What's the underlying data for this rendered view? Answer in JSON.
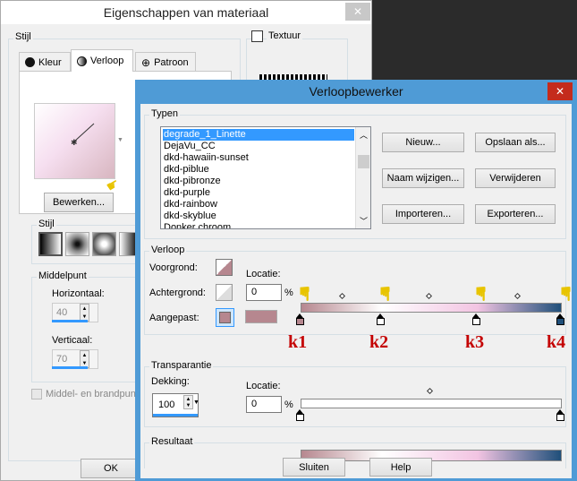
{
  "bg_dialog": {
    "title": "Eigenschappen van materiaal",
    "close_glyph": "✕",
    "group_stijl": "Stijl",
    "tabs": [
      "Kleur",
      "Verloop",
      "Patroon"
    ],
    "bewerken_button": "Bewerken...",
    "substijl_label": "Stijl",
    "middelpunt_label": "Middelpunt",
    "horizontaal_label": "Horizontaal:",
    "horizontaal_value": "40",
    "verticaal_label": "Verticaal:",
    "verticaal_value": "70",
    "middel_checkbox": "Middel- en brandpunt",
    "textuur_label": "Textuur",
    "ok_button": "OK"
  },
  "dialog": {
    "title": "Verloopbewerker",
    "close_glyph": "✕",
    "typen_label": "Typen",
    "typen_items": [
      "degrade_1_Linette",
      "DejaVu_CC",
      "dkd-hawaiin-sunset",
      "dkd-piblue",
      "dkd-pibronze",
      "dkd-purple",
      "dkd-rainbow",
      "dkd-skyblue",
      "Donker chroom"
    ],
    "selected_index": 0,
    "buttons": {
      "nieuw": "Nieuw...",
      "opslaan": "Opslaan als...",
      "naam": "Naam wijzigen...",
      "verwijderen": "Verwijderen",
      "importeren": "Importeren...",
      "exporteren": "Exporteren..."
    },
    "verloop_label": "Verloop",
    "voorgrond_label": "Voorgrond:",
    "achtergrond_label": "Achtergrond:",
    "aangepast_label": "Aangepast:",
    "locatie_label": "Locatie:",
    "locatie_value": "0",
    "percent": "%",
    "transparantie_label": "Transparantie",
    "dekking_label": "Dekking:",
    "dekking_value": "100",
    "locatie2_label": "Locatie:",
    "locatie2_value": "0",
    "resultaat_label": "Resultaat",
    "sluiten_button": "Sluiten",
    "help_button": "Help"
  },
  "stop_labels": [
    "k1",
    "k2",
    "k3",
    "k4"
  ],
  "colors": {
    "stop1": "#b6878f",
    "stop2": "#ffffff",
    "stop3": "#f2c4e2",
    "stop4": "#1f4f7a",
    "selection": "#3399ff",
    "title_bar": "#4f9bd6",
    "close_red": "#c42b1c",
    "annot_red": "#c40000"
  },
  "icons": {
    "hand": "pointing-hand-icon",
    "close": "close-icon"
  }
}
